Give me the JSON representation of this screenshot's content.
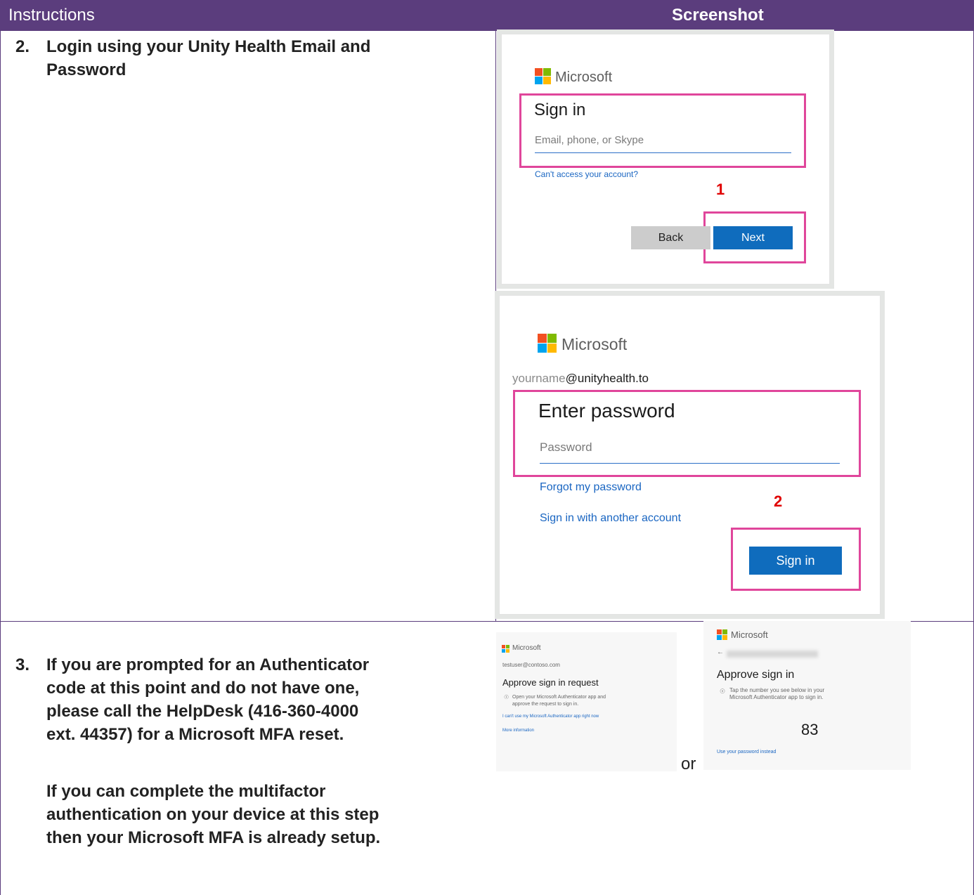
{
  "header": {
    "left": "Instructions",
    "right": "Screenshot"
  },
  "step2": {
    "number": "2.",
    "text_line1": "Login using your Unity Health Email and",
    "text_line2": "Password"
  },
  "signin_card": {
    "brand": "Microsoft",
    "title": "Sign in",
    "placeholder": "Email, phone, or Skype",
    "link": "Can't access your account?",
    "callout": "1",
    "back_label": "Back",
    "next_label": "Next"
  },
  "password_card": {
    "brand": "Microsoft",
    "identity_name": "yourname",
    "identity_domain": "@unityhealth.to",
    "title": "Enter password",
    "placeholder": "Password",
    "forgot_link": "Forgot my password",
    "other_account_link": "Sign in with another account",
    "callout": "2",
    "signin_label": "Sign in"
  },
  "step3": {
    "number": "3.",
    "para1": [
      "If you are prompted for an Authenticator",
      "code at this point and do not have one,",
      "please call the HelpDesk (416-360-4000",
      "ext. 44357) for a Microsoft MFA reset."
    ],
    "para2": [
      "If you can complete the multifactor",
      "authentication on your device at this step",
      "then your Microsoft MFA is already setup."
    ]
  },
  "approve_card_a": {
    "brand": "Microsoft",
    "email": "testuser@contoso.com",
    "title": "Approve sign in request",
    "body_line1": "Open your Microsoft Authenticator app and",
    "body_line2": "approve the request to sign in.",
    "link1": "I can't use my Microsoft Authenticator app right now",
    "link2": "More information"
  },
  "or_label": "or",
  "approve_card_b": {
    "brand": "Microsoft",
    "title": "Approve sign in",
    "body_line1": "Tap the number you see below in your",
    "body_line2": "Microsoft Authenticator app to sign in.",
    "number": "83",
    "link": "Use your password instead"
  },
  "colors": {
    "header": "#5b3d7d",
    "highlight": "#e0469b",
    "callout": "#e00000",
    "primary": "#0f6cbd"
  }
}
